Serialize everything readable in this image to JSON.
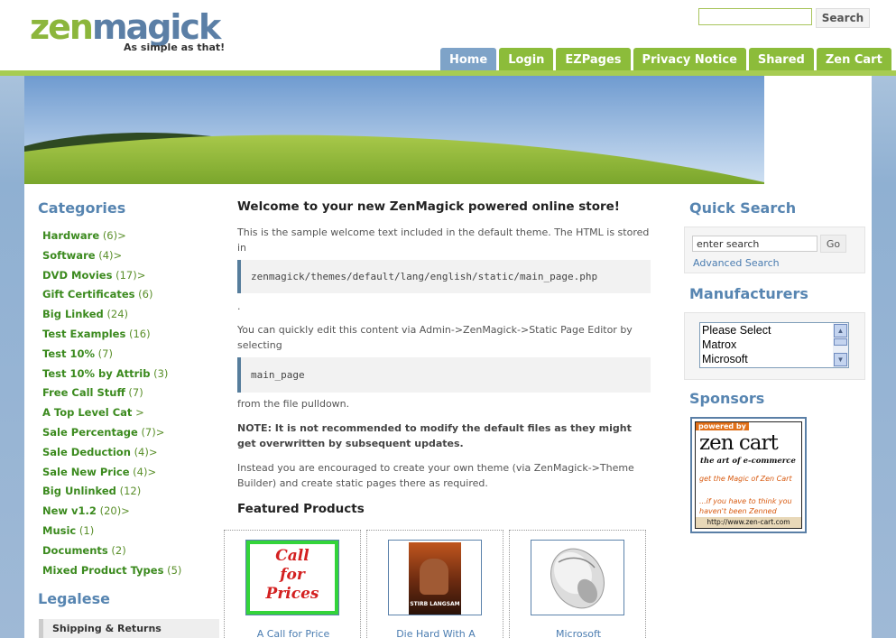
{
  "logo": {
    "zen": "zen",
    "magick": "magick",
    "tagline": "As simple as that!"
  },
  "top_search": {
    "value": "",
    "button": "Search"
  },
  "nav": {
    "tabs": [
      "Home",
      "Login",
      "EZPages",
      "Privacy Notice",
      "Shared",
      "Zen Cart"
    ],
    "active": "Home"
  },
  "categories": {
    "title": "Categories",
    "items": [
      {
        "name": "Hardware",
        "count": "(6)>"
      },
      {
        "name": "Software",
        "count": "(4)>"
      },
      {
        "name": "DVD Movies",
        "count": "(17)>"
      },
      {
        "name": "Gift Certificates",
        "count": "(6)"
      },
      {
        "name": "Big Linked",
        "count": "(24)"
      },
      {
        "name": "Test Examples",
        "count": "(16)"
      },
      {
        "name": "Test 10%",
        "count": "(7)"
      },
      {
        "name": "Test 10% by Attrib",
        "count": "(3)"
      },
      {
        "name": "Free Call Stuff",
        "count": "(7)"
      },
      {
        "name": "A Top Level Cat",
        "count": ">"
      },
      {
        "name": "Sale Percentage",
        "count": "(7)>"
      },
      {
        "name": "Sale Deduction",
        "count": "(4)>"
      },
      {
        "name": "Sale New Price",
        "count": "(4)>"
      },
      {
        "name": "Big Unlinked",
        "count": "(12)"
      },
      {
        "name": "New v1.2",
        "count": "(20)>"
      },
      {
        "name": "Music",
        "count": "(1)"
      },
      {
        "name": "Documents",
        "count": "(2)"
      },
      {
        "name": "Mixed Product Types",
        "count": "(5)"
      }
    ]
  },
  "legalese": {
    "title": "Legalese",
    "items": [
      "Shipping & Returns"
    ]
  },
  "main": {
    "heading": "Welcome to your new ZenMagick powered online store!",
    "p1": "This is the sample welcome text included in the default theme. The HTML is stored in",
    "code1": "zenmagick/themes/default/lang/english/static/main_page.php",
    "p_dot": ".",
    "p2": "You can quickly edit this content via Admin->ZenMagick->Static Page Editor by selecting",
    "code2": "main_page",
    "p3": "from the file pulldown.",
    "note": "NOTE: It is not recommended to modify the default files as they might get overwritten by subsequent updates.",
    "p4": "Instead you are encouraged to create your own theme (via ZenMagick->Theme Builder) and create static pages there as required.",
    "featured_title": "Featured Products",
    "products": [
      {
        "name": "A Call for Price",
        "image_text": [
          "Call",
          "for",
          "Prices"
        ]
      },
      {
        "name": "Die Hard With A",
        "image_text": [
          "STIRB LANGSAM"
        ]
      },
      {
        "name": "Microsoft",
        "image_text": []
      }
    ]
  },
  "quick_search": {
    "title": "Quick Search",
    "placeholder": "enter search",
    "go": "Go",
    "advanced": "Advanced Search"
  },
  "manufacturers": {
    "title": "Manufacturers",
    "options": [
      "Please Select",
      "Matrox",
      "Microsoft"
    ]
  },
  "sponsors": {
    "title": "Sponsors",
    "ad": {
      "powered_by": "powered by",
      "brand": "zen cart",
      "subtitle": "the art of e-commerce",
      "line1": "get the Magic of Zen Cart",
      "line2": "...if you have to think you haven't been Zenned",
      "url": "http://www.zen-cart.com"
    }
  },
  "colors": {
    "green": "#8cbc3a",
    "blue": "#5785b1",
    "link": "#4a7cb0",
    "cat_green": "#3b8a1e"
  }
}
